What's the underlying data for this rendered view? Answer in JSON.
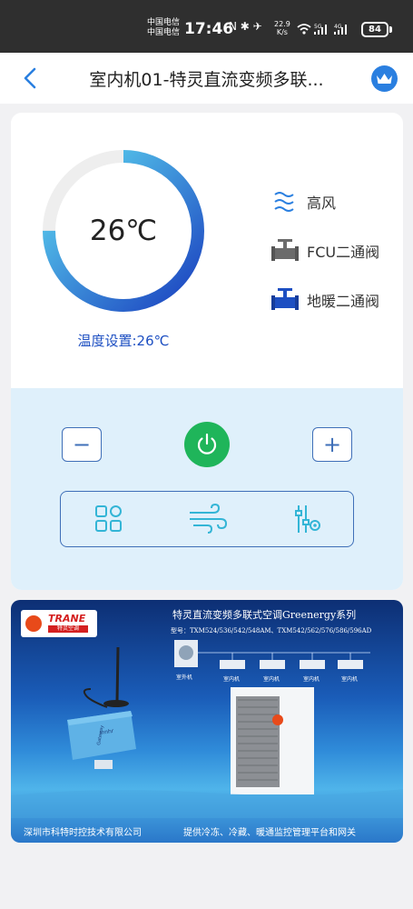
{
  "status_bar": {
    "carrier_1": "中国电信",
    "carrier_2": "中国电信",
    "time": "17:46",
    "icons_text": "N ✱ ✈",
    "net_speed_value": "22.9",
    "net_speed_unit": "K/s",
    "signal_labels": [
      "5G",
      "4G"
    ],
    "battery": "84"
  },
  "nav": {
    "title": "室内机01-特灵直流变频多联..."
  },
  "gauge": {
    "temperature": "26℃",
    "setpoint_label": "温度设置:26℃",
    "fill_fraction": 0.75,
    "colors": {
      "track": "#eeeeee",
      "start": "#1a3fbf",
      "end": "#5fdcf2"
    }
  },
  "status": {
    "fan": "高风",
    "fcu_valve": "FCU二通阀",
    "floor_valve": "地暖二通阀"
  },
  "controls": {
    "decrease": "−",
    "increase": "+"
  },
  "colors": {
    "accent": "#3f6fb8",
    "power": "#1fb55a",
    "card_bottom": "#dff0fb",
    "setpoint_text": "#1d4fc2"
  },
  "banner": {
    "logo_brand": "TRANE",
    "logo_sub": "特灵空调",
    "title": "特灵直流变频多联式空调Greenergy系列",
    "models": "型号：TXM524/536/542/548AM、TXM542/562/576/586/596AD",
    "outdoor_label": "室外机",
    "indoor_labels": [
      "室内机",
      "室内机",
      "室内机",
      "室内机"
    ],
    "gateway_brand": "Innhr",
    "gateway_text": "Gateway",
    "company": "深圳市科特时控技术有限公司",
    "slogan": "提供冷冻、冷藏、暖通监控管理平台和网关"
  }
}
